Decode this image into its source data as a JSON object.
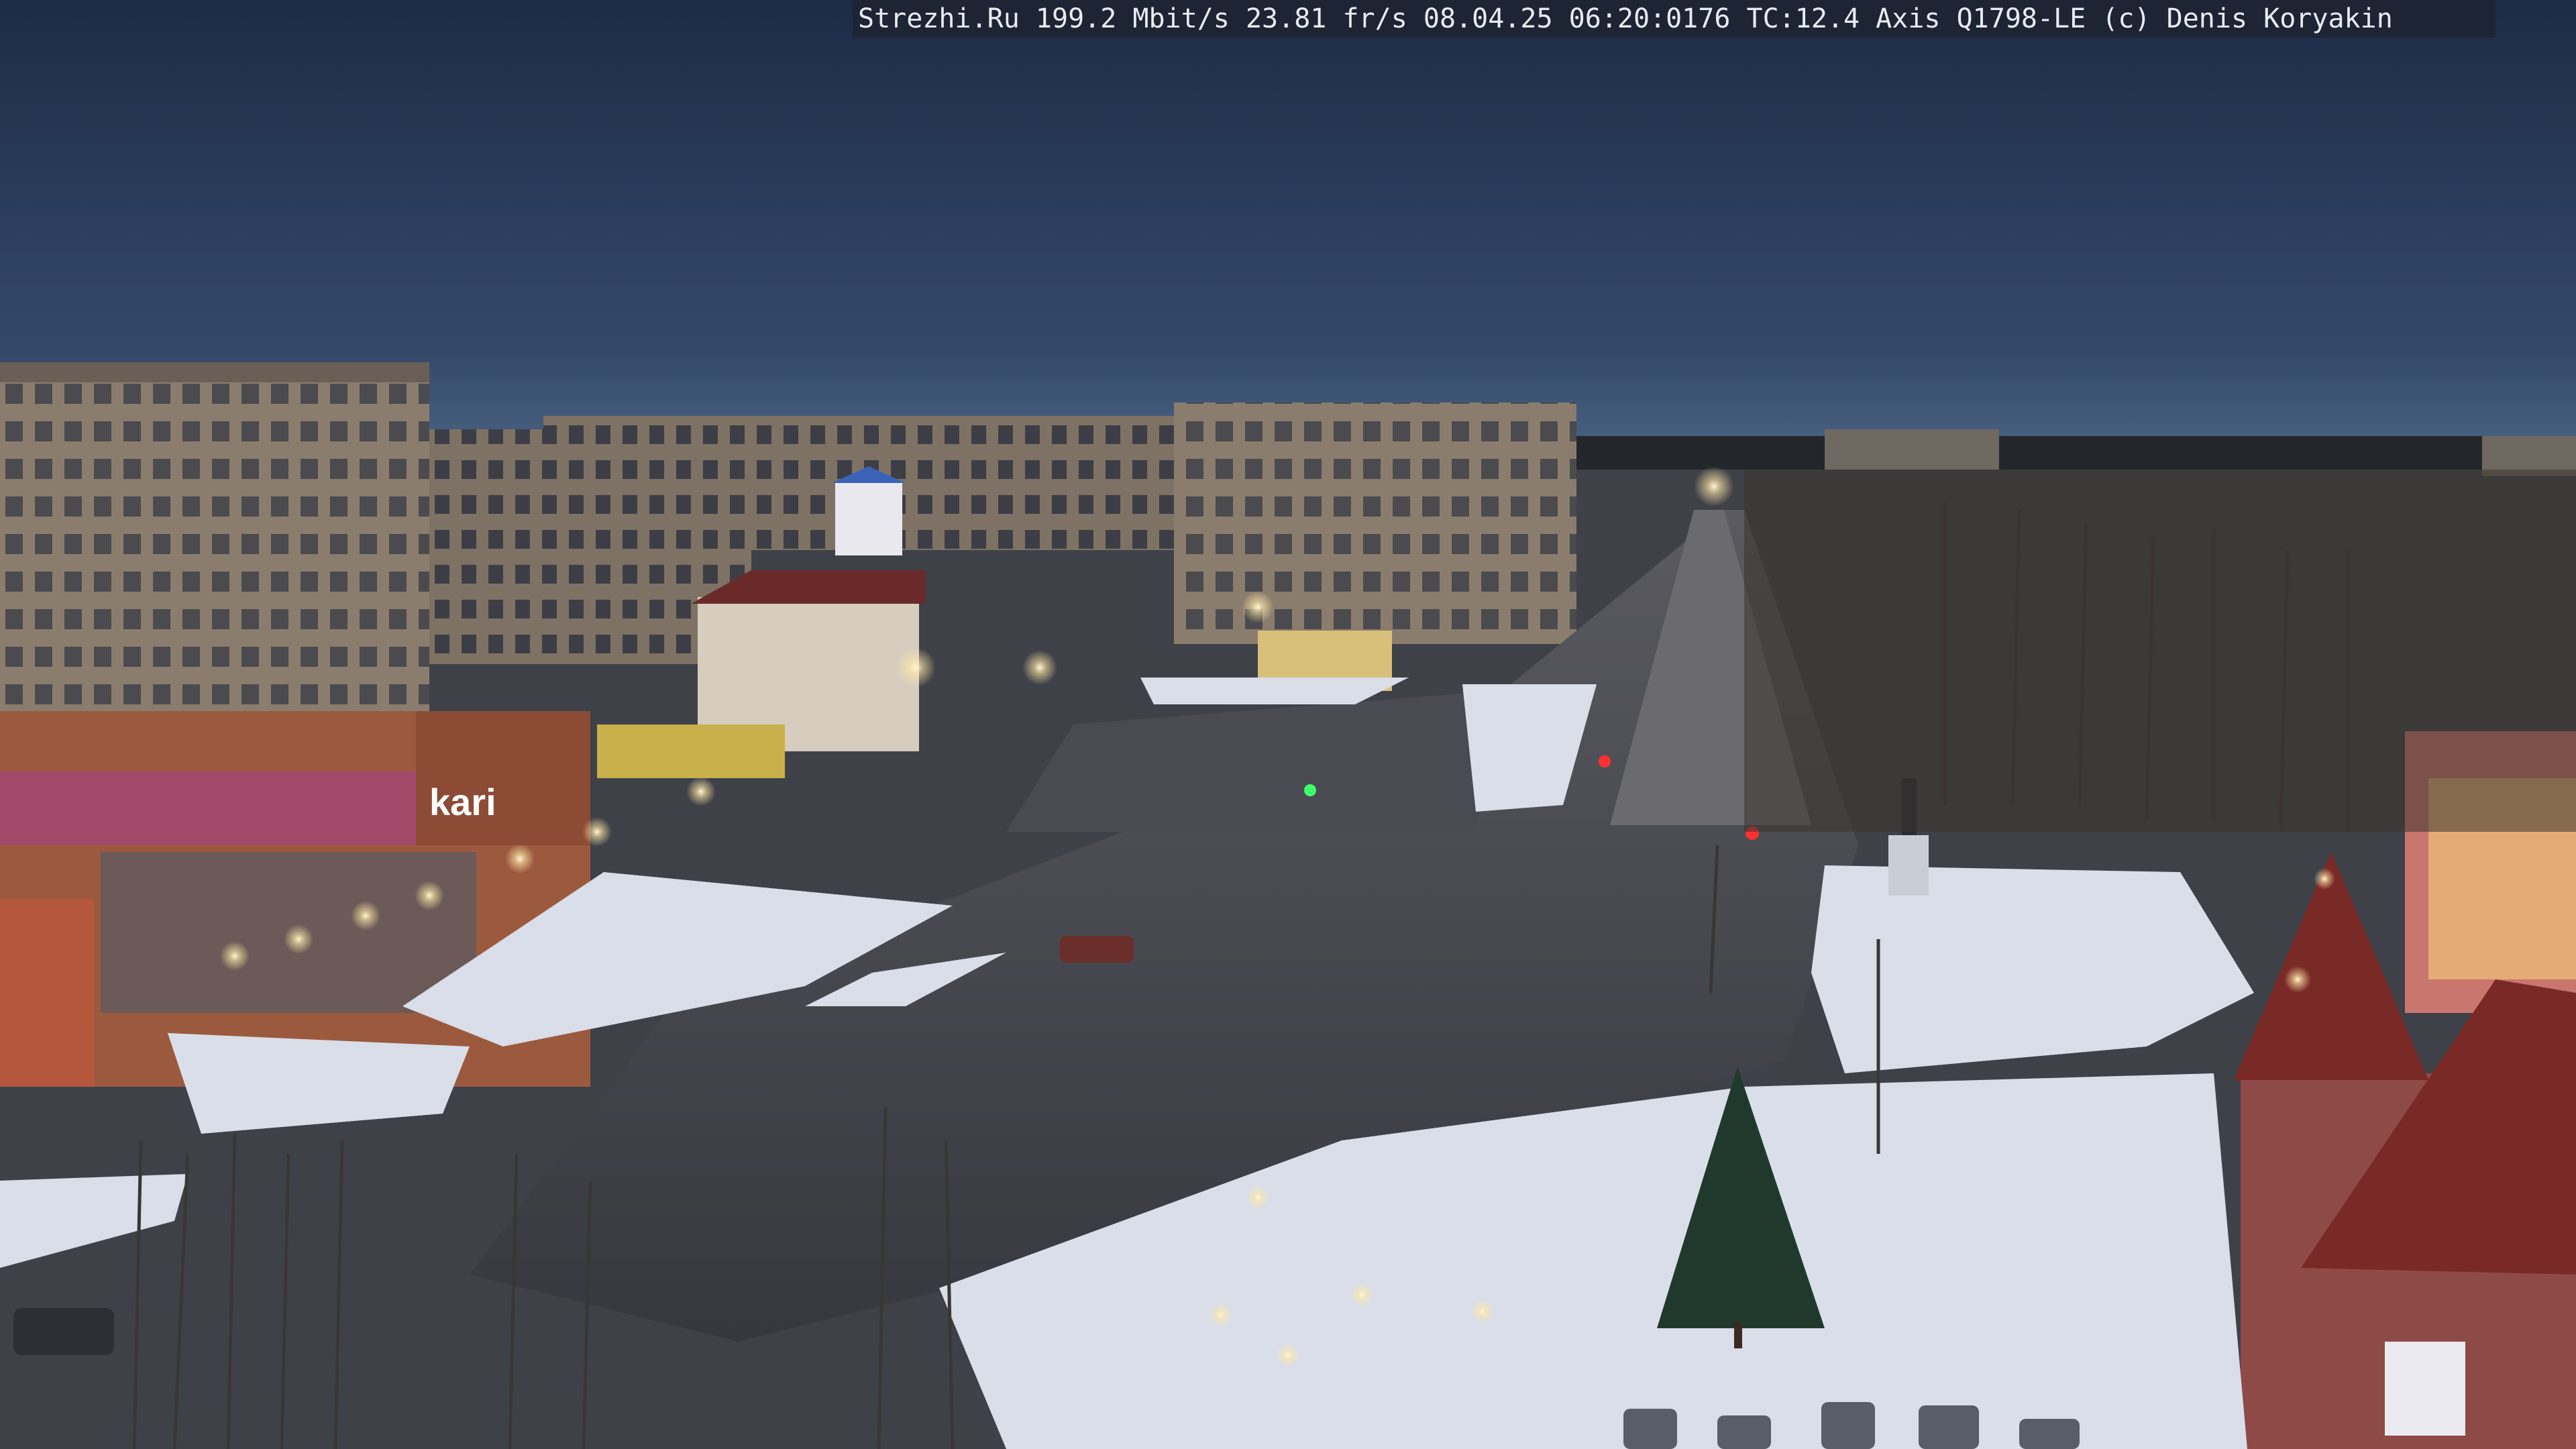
{
  "overlay": {
    "text": "Strezhi.Ru 199.2 Mbit/s 23.81 fr/s 08.04.25 06:20:0176 TC:12.4  Axis Q1798-LE  (c) Denis Koryakin"
  },
  "storefront": {
    "brand_logo": "kari"
  },
  "colors": {
    "sky_top": "#1d2b47",
    "sky_horizon": "#4a6383",
    "road": "#3b3d45",
    "snow": "#d8dde8",
    "building": "#8a7a6a",
    "street_light": "#fff4d0",
    "traffic_green": "#3cff6a",
    "traffic_red": "#ff3030"
  },
  "scene": {
    "description_icons": [
      "building",
      "road",
      "street-light",
      "tree",
      "snow",
      "traffic-light",
      "monument",
      "parked-car"
    ]
  }
}
